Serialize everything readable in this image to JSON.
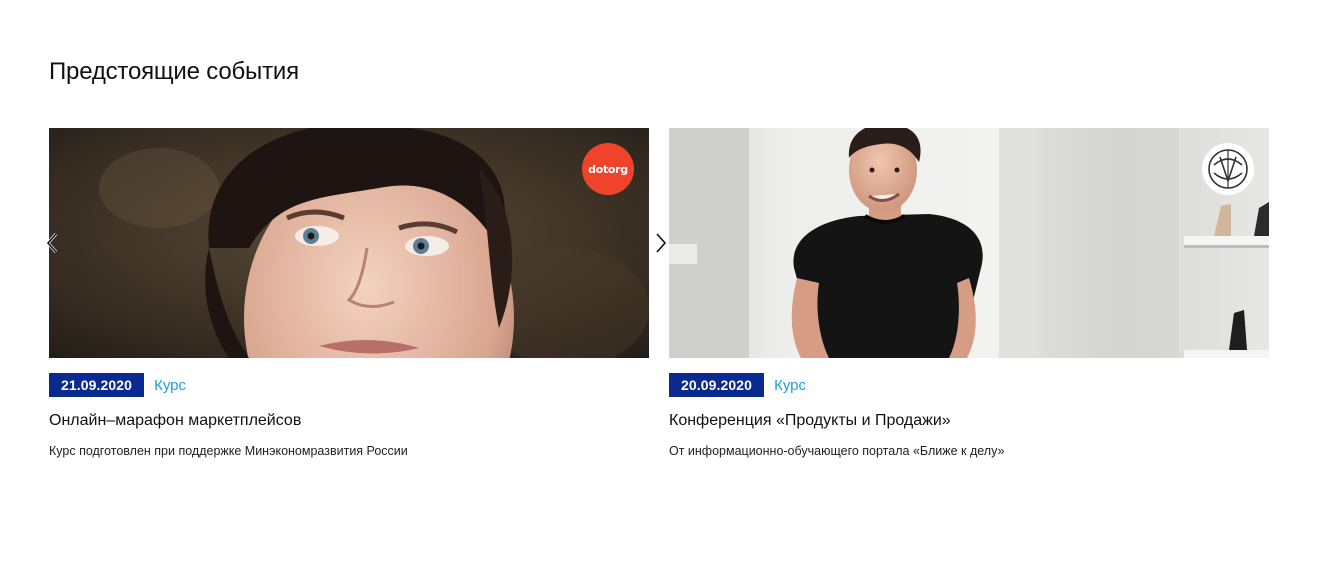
{
  "section": {
    "title": "Предстоящие события"
  },
  "carousel": {
    "prev_icon": "chevron-left-icon",
    "next_icon": "chevron-right-icon",
    "cards": [
      {
        "date": "21.09.2020",
        "type": "Курс",
        "title": "Онлайн–марафон маркетплейсов",
        "description": "Курс подготовлен при поддержке Минэкономразвития России",
        "logo_text": "dotorg",
        "logo_color": "#f0432b"
      },
      {
        "date": "20.09.2020",
        "type": "Курс",
        "title": "Конференция «Продукты и Продажи»",
        "description": "От информационно-обучающего портала «Ближе к делу»",
        "logo_icon": "portal-logo-icon"
      }
    ]
  },
  "colors": {
    "date_badge_bg": "#0b2a8f",
    "type_tag": "#1aa0e0"
  }
}
